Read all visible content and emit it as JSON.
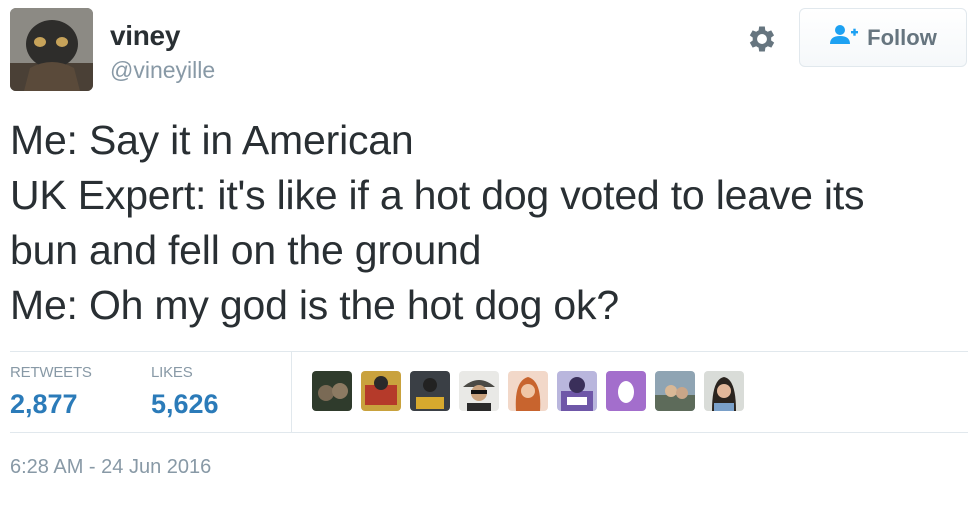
{
  "author": {
    "display_name": "viney",
    "username": "@vineyille"
  },
  "actions": {
    "follow_label": "Follow"
  },
  "tweet": {
    "lines": [
      "Me: Say it in American",
      "UK Expert: it's like if a hot dog voted to leave its",
      "bun and fell on the ground",
      "Me: Oh my god is the hot dog ok?"
    ]
  },
  "stats": {
    "retweets_label": "RETWEETS",
    "retweets_count": "2,877",
    "likes_label": "LIKES",
    "likes_count": "5,626"
  },
  "timestamp": "6:28 AM - 24 Jun 2016",
  "colors": {
    "link_blue": "#2b7bb9",
    "follow_icon_blue": "#1da1f2",
    "muted": "#8899a6",
    "text": "#292f33"
  }
}
